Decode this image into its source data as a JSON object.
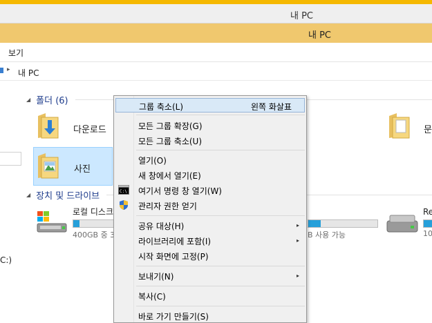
{
  "window": {
    "title_inactive": "내 PC",
    "title_active": "내 PC",
    "accent_color": "#f5b800",
    "active_title_bg": "#f0c86e"
  },
  "ribbon": {
    "tab_view": "보기"
  },
  "address": {
    "crumb": "내 PC"
  },
  "nav_pane": {
    "drive_fragment": "C:)"
  },
  "folders_group": {
    "label": "폴더 (6)",
    "items": [
      {
        "name": "다운로드",
        "icon": "downloads-folder-icon"
      },
      {
        "name": "사진",
        "icon": "pictures-folder-icon",
        "selected": true
      },
      {
        "name": "문",
        "icon": "documents-folder-icon"
      }
    ]
  },
  "devices_group": {
    "label": "장치 및 드라이브",
    "drives": [
      {
        "name": "로컬 디스크",
        "free_text": "400GB 중 3",
        "icon": "windows-drive-icon",
        "used_fraction": 0.15
      },
      {
        "free_text": "B 사용 가능",
        "used_fraction": 0.18
      },
      {
        "name": "Re",
        "free_text": "10",
        "icon": "removable-drive-icon"
      }
    ]
  },
  "context_menu": {
    "items": [
      {
        "label": "그룹 축소(L)",
        "shortcut": "왼쪽 화살표",
        "highlighted": true
      },
      {
        "label": "모든 그룹 확장(G)"
      },
      {
        "label": "모든 그룹 축소(U)"
      },
      {
        "label": "열기(O)"
      },
      {
        "label": "새 창에서 열기(E)"
      },
      {
        "label": "여기서 명령 창 열기(W)",
        "icon": "cmd-icon"
      },
      {
        "label": "관리자 권한 얻기",
        "icon": "uac-shield-icon"
      },
      {
        "label": "공유 대상(H)",
        "submenu": true
      },
      {
        "label": "라이브러리에 포함(I)",
        "submenu": true
      },
      {
        "label": "시작 화면에 고정(P)"
      },
      {
        "label": "보내기(N)",
        "submenu": true
      },
      {
        "label": "복사(C)"
      },
      {
        "label": "바로 가기 만들기(S)"
      }
    ],
    "submenu_arrow": "▸",
    "highlight_color": "#d9e9f7"
  }
}
